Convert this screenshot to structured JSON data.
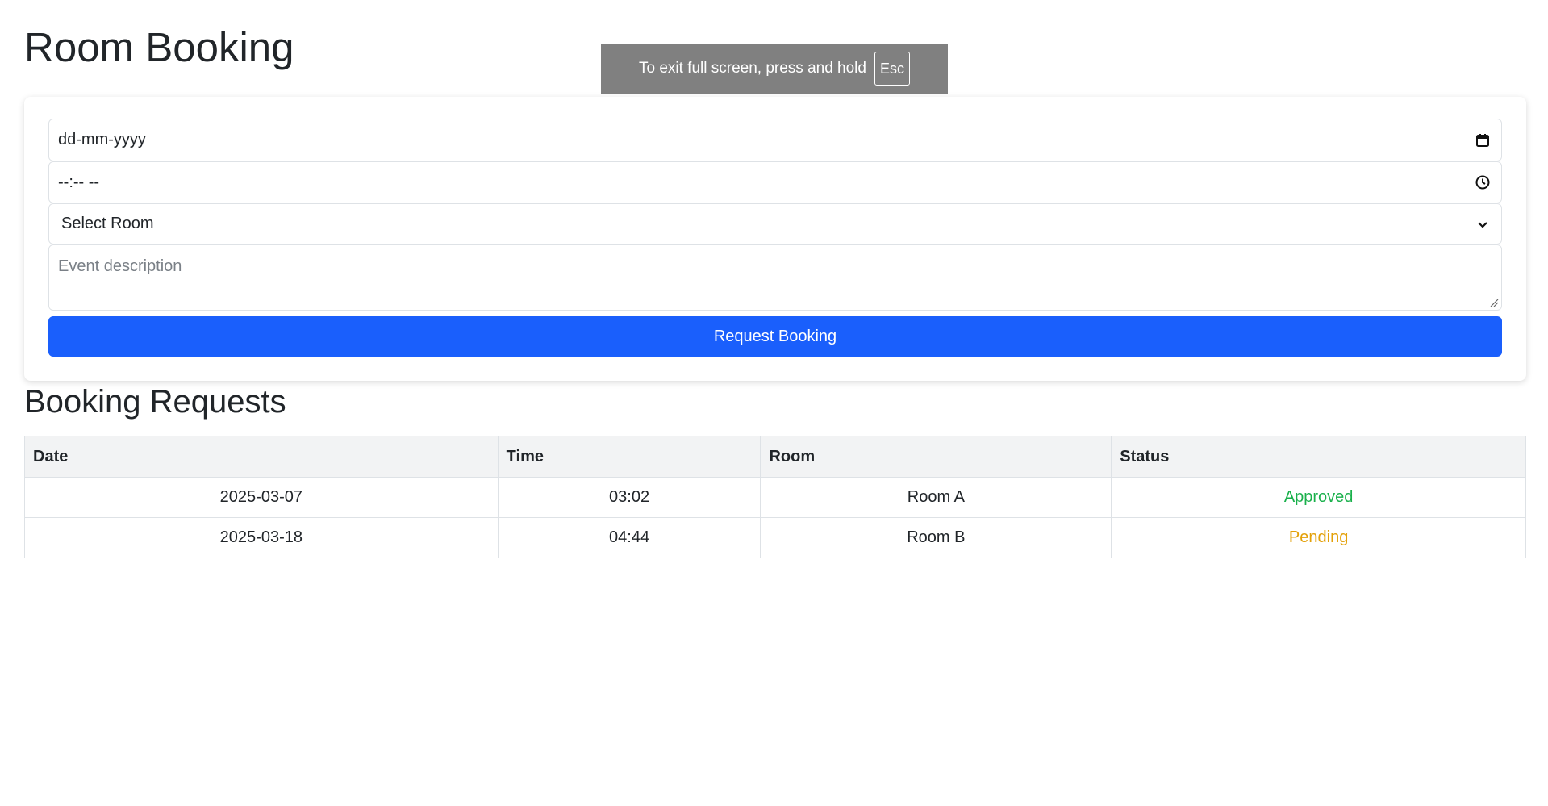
{
  "page": {
    "title": "Room Booking"
  },
  "fullscreen_notice": {
    "text": "To exit full screen, press and hold",
    "key": "Esc"
  },
  "form": {
    "date_value": "dd-mm-yyyy",
    "time_value": "--:-- --",
    "room_selected": "Select Room",
    "description_placeholder": "Event description",
    "submit_label": "Request Booking"
  },
  "requests": {
    "title": "Booking Requests",
    "columns": [
      "Date",
      "Time",
      "Room",
      "Status"
    ],
    "rows": [
      {
        "date": "2025-03-07",
        "time": "03:02",
        "room": "Room A",
        "status": "Approved",
        "status_color": "#19b04b"
      },
      {
        "date": "2025-03-18",
        "time": "04:44",
        "room": "Room B",
        "status": "Pending",
        "status_color": "#e3a008"
      }
    ]
  },
  "colors": {
    "accent": "#1a5ffc",
    "approved": "#19b04b",
    "pending": "#e3a008"
  },
  "icons": {
    "date": "calendar-icon",
    "time": "clock-icon",
    "select": "chevron-down-icon"
  }
}
